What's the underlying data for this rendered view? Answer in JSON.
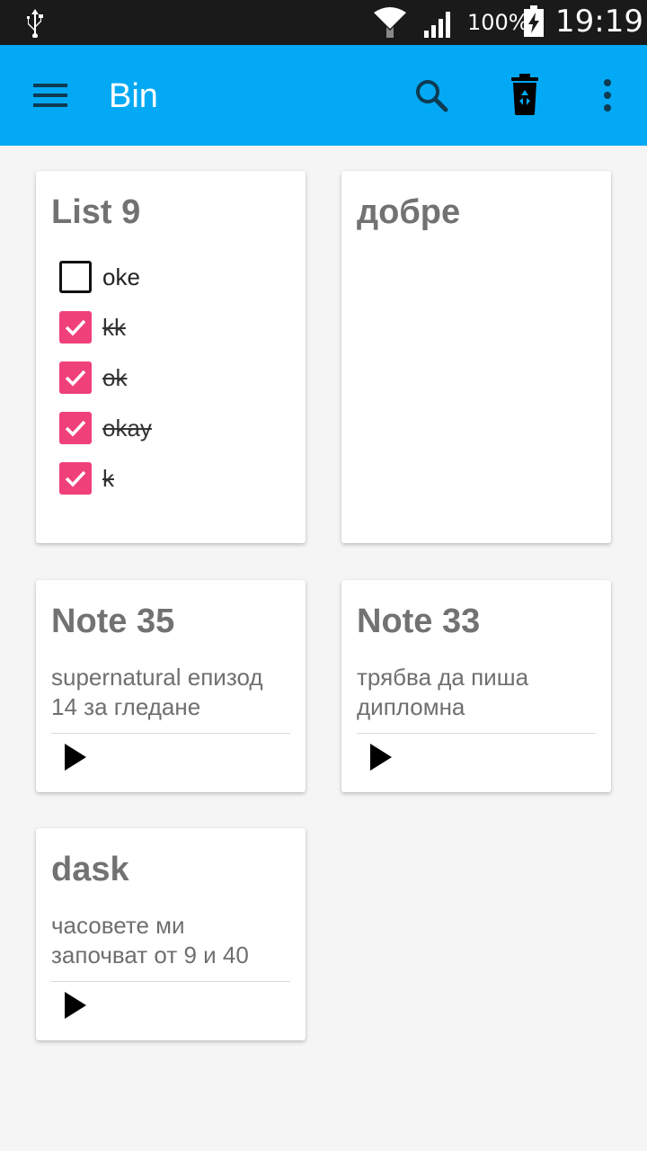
{
  "status_bar": {
    "battery_percent": "100%",
    "time": "19:19",
    "icons": [
      "usb-icon",
      "wifi-icon",
      "signal-icon",
      "battery-charging-icon"
    ]
  },
  "app_bar": {
    "title": "Bin",
    "color": "#03a9f4",
    "icons": [
      "menu-icon",
      "search-icon",
      "recycle-bin-icon",
      "more-vert-icon"
    ]
  },
  "notes": {
    "list9": {
      "title": "List 9",
      "items": [
        {
          "label": "oke",
          "checked": false
        },
        {
          "label": "kk",
          "checked": true
        },
        {
          "label": "ok",
          "checked": true
        },
        {
          "label": "okay",
          "checked": true
        },
        {
          "label": "k",
          "checked": true
        }
      ]
    },
    "dobre": {
      "title": "добре"
    },
    "note35": {
      "title": "Note 35",
      "body_line1": "supernatural епизод",
      "body_line2": "14 за гледане"
    },
    "note33": {
      "title": "Note 33",
      "body_line1": "трябва да пиша",
      "body_line2": "дипломна"
    },
    "dask": {
      "title": "dask",
      "body_line1": "часовете ми",
      "body_line2": "започват от 9 и 40"
    }
  },
  "colors": {
    "checkbox_checked": "#f0407a",
    "title_text": "#727272"
  }
}
